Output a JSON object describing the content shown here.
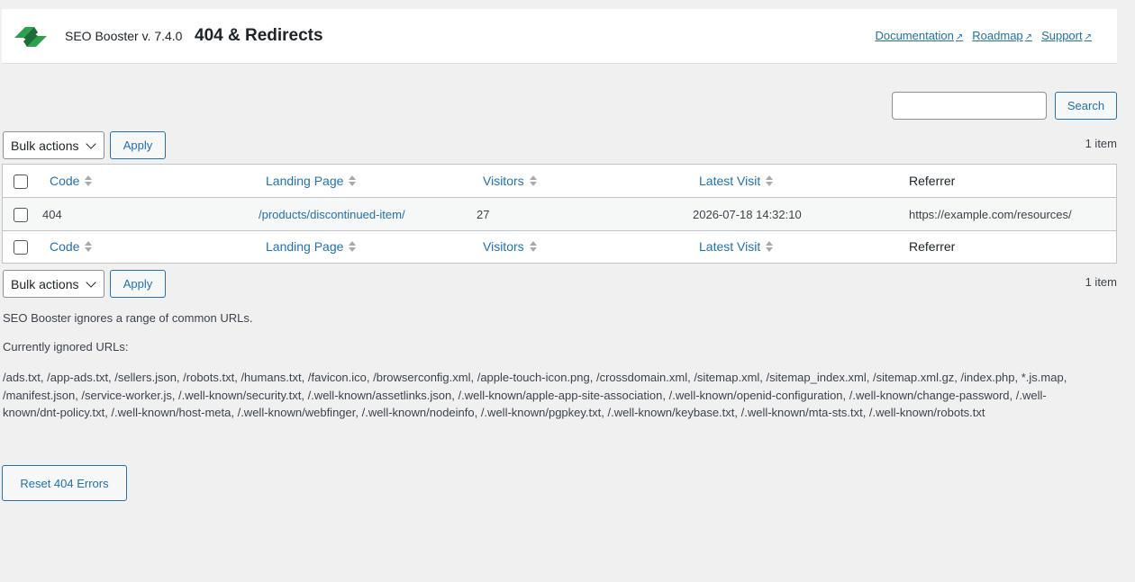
{
  "header": {
    "app_name": "SEO Booster v. 7.4.0",
    "page_title": "404 & Redirects",
    "links": [
      {
        "label": "Documentation",
        "icon": "external-link-icon"
      },
      {
        "label": "Roadmap",
        "icon": "external-link-icon"
      },
      {
        "label": "Support",
        "icon": "external-link-icon"
      }
    ],
    "logo_colors": [
      "#1a7a3a",
      "#2f9f4f"
    ]
  },
  "search": {
    "value": "",
    "button_label": "Search"
  },
  "bulk": {
    "selected": "Bulk actions",
    "apply_label": "Apply"
  },
  "item_count": "1 item",
  "table": {
    "columns": [
      "Code",
      "Landing Page",
      "Visitors",
      "Latest Visit",
      "Referrer"
    ],
    "rows": [
      {
        "code": "404",
        "landing_page": "/products/discontinued-item/",
        "visitors": "27",
        "latest_visit": "2026-07-18 14:32:10",
        "referrer": "https://example.com/resources/"
      }
    ]
  },
  "notes": {
    "intro": "SEO Booster ignores a range of common URLs.",
    "ignored_heading": "Currently ignored URLs:",
    "ignored_urls": "/ads.txt, /app-ads.txt, /sellers.json, /robots.txt, /humans.txt, /favicon.ico, /browserconfig.xml, /apple-touch-icon.png, /crossdomain.xml, /sitemap.xml, /sitemap_index.xml, /sitemap.xml.gz, /index.php, *.js.map, /manifest.json, /service-worker.js, /.well-known/security.txt, /.well-known/assetlinks.json, /.well-known/apple-app-site-association, /.well-known/openid-configuration, /.well-known/change-password, /.well-known/dnt-policy.txt, /.well-known/host-meta, /.well-known/webfinger, /.well-known/nodeinfo, /.well-known/pgpkey.txt, /.well-known/keybase.txt, /.well-known/mta-sts.txt, /.well-known/robots.txt"
  },
  "reset_label": "Reset 404 Errors"
}
